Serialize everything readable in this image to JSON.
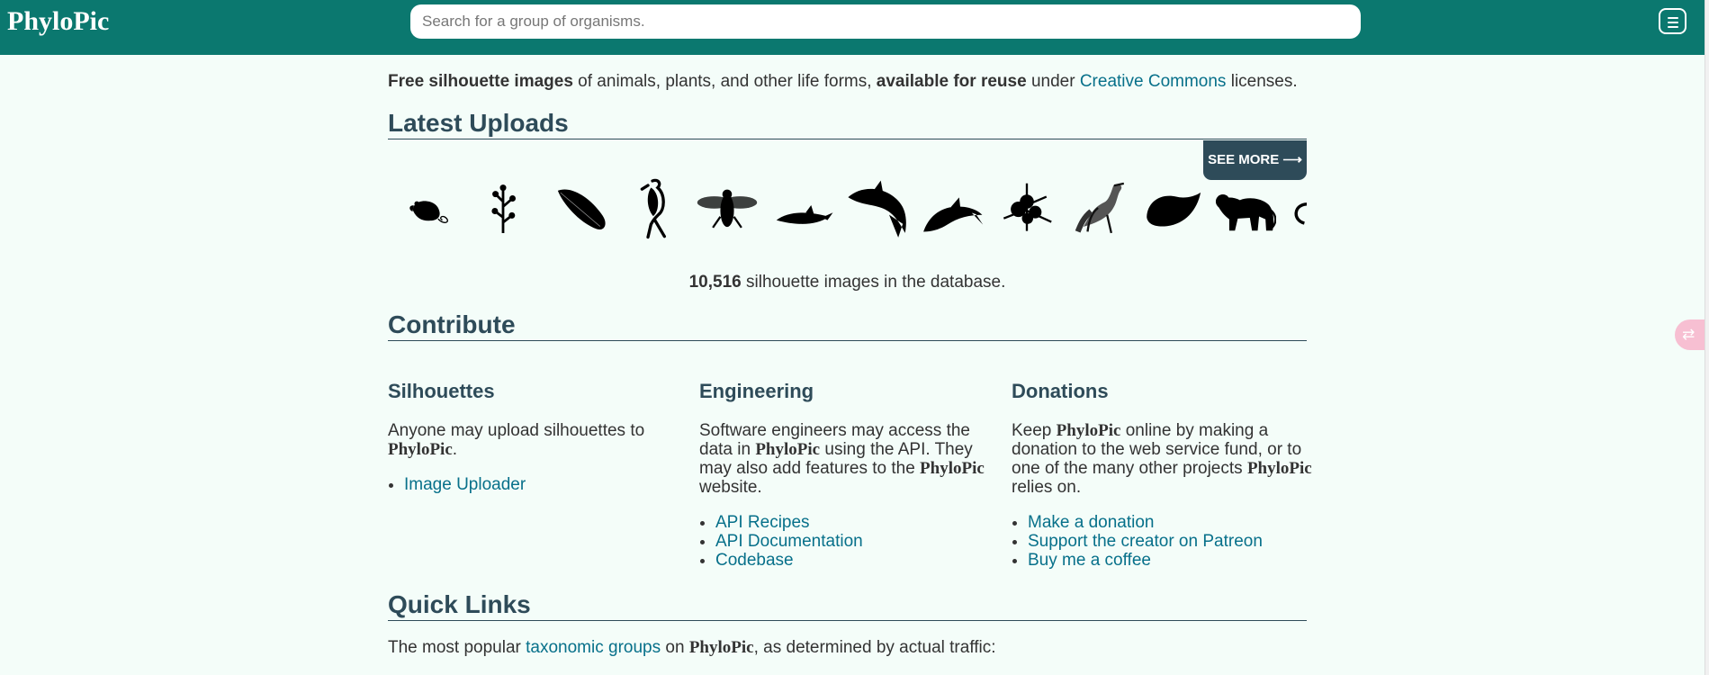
{
  "header": {
    "brand": "PhyloPic",
    "search_placeholder": "Search for a group of organisms.",
    "menu_icon": "menu-icon"
  },
  "intro": {
    "part1": "Free silhouette images",
    "part2": " of animals, plants, and other life forms, ",
    "part3": "available for reuse",
    "part4": " under ",
    "link": "Creative Commons",
    "part5": " licenses."
  },
  "latest": {
    "title": "Latest Uploads",
    "see_more": "SEE MORE ⟶",
    "thumbnails": [
      "mouse-silhouette",
      "plant-silhouette",
      "leaf-silhouette",
      "bird-standing-silhouette",
      "bee-silhouette",
      "dolphin-silhouette",
      "dolphin-silhouette",
      "dolphin-silhouette",
      "flower-silhouette",
      "vulture-silhouette",
      "seed-silhouette",
      "big-cat-silhouette",
      "curl-silhouette"
    ],
    "count_number": "10,516",
    "count_text": " silhouette images in the database."
  },
  "contribute": {
    "title": "Contribute",
    "silhouettes": {
      "heading": "Silhouettes",
      "text": "Anyone may upload silhouettes to ",
      "brand": "PhyloPic",
      "after_brand": ".",
      "links": [
        "Image Uploader"
      ]
    },
    "engineering": {
      "heading": "Engineering",
      "text1": "Software engineers may access the data in ",
      "brand1": "PhyloPic",
      "text2": " using the API. They may also add features to the ",
      "brand2": "PhyloPic",
      "text3": " website.",
      "links": [
        "API Recipes",
        "API Documentation",
        "Codebase"
      ]
    },
    "donations": {
      "heading": "Donations",
      "text1": "Keep ",
      "brand1": "PhyloPic",
      "text2": " online by making a donation to the web service fund, or to one of the many other projects ",
      "brand2": "PhyloPic",
      "text3": " relies on.",
      "links": [
        "Make a donation",
        "Support the creator on Patreon",
        "Buy me a coffee"
      ]
    }
  },
  "quick_links": {
    "title": "Quick Links",
    "text1": "The most popular ",
    "link": "taxonomic groups",
    "text2": " on ",
    "brand": "PhyloPic",
    "text3": ", as determined by actual traffic:"
  },
  "colors": {
    "header": "#0b786f",
    "background": "#f4fdf9",
    "heading": "#2e4b59",
    "link": "#07708a"
  }
}
